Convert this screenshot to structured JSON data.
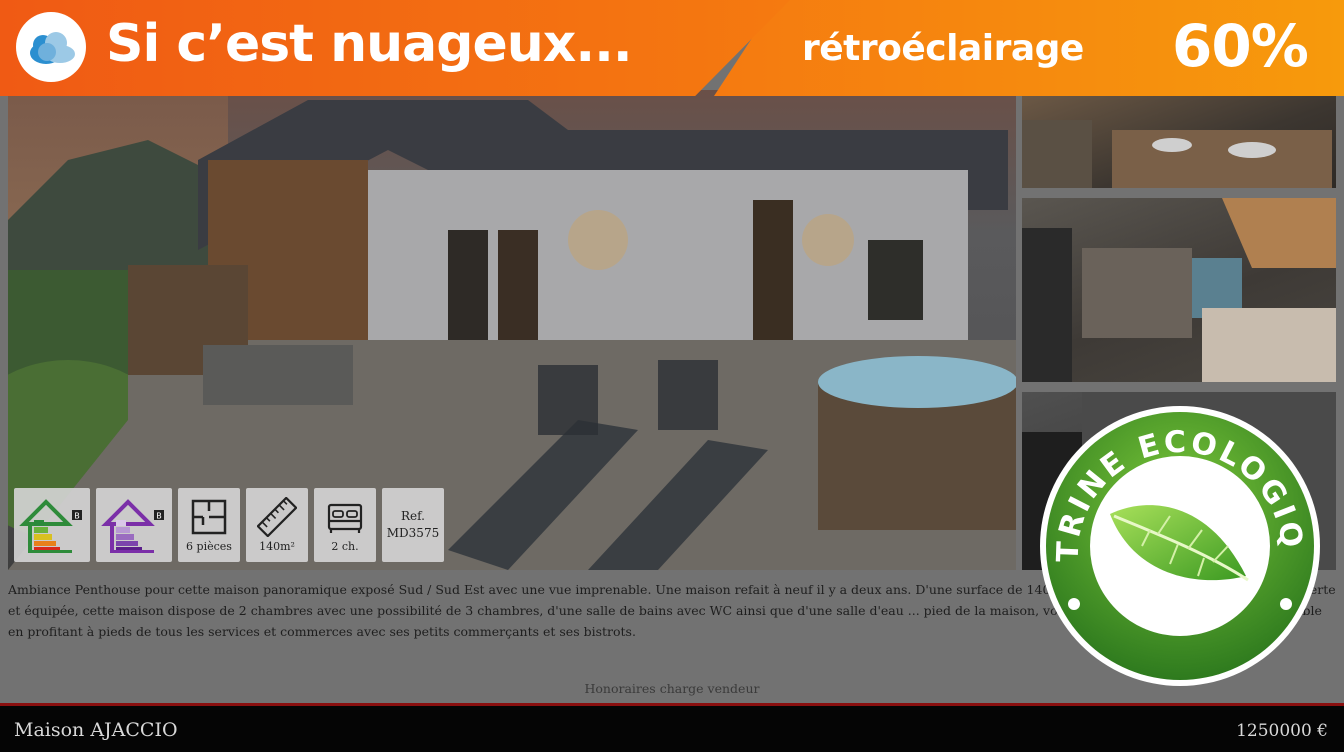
{
  "banner": {
    "title": "Si c’est nuageux...",
    "subtitle": "rétroéclairage",
    "percentage": "60%",
    "icon": "cloud-icon",
    "colors": {
      "left": "#f05a14",
      "right": "#f79a0c"
    }
  },
  "features": [
    {
      "icon": "energy-rating-icon",
      "grade": "B",
      "color": "#2e8b3a"
    },
    {
      "icon": "ghg-rating-icon",
      "grade": "B",
      "color": "#7b2fa8"
    },
    {
      "icon": "floor-plan-icon",
      "label": "6 pièces"
    },
    {
      "icon": "ruler-icon",
      "label": "140m²"
    },
    {
      "icon": "bed-icon",
      "label": "2 ch."
    },
    {
      "ref_label": "Ref.",
      "ref_value": "MD3575"
    }
  ],
  "description": "Ambiance Penthouse pour cette maison panoramique exposé Sud / Sud Est avec une vue imprenable. Une maison refait à neuf il y a deux ans. D'une surface de 140 m² et ... s de 60 m² avec une cuisine ouverte et équipée, cette maison dispose de 2 chambres avec une possibilité de 3 chambres, d'une salle de bains avec WC ainsi que d'une salle d'eau ... pied de la maison, vous trouverez une vie de quartier agréable en profitant à pieds de tous les services et commerces avec ses petits commerçants et ses bistrots.",
  "fees": "Honoraires charge vendeur",
  "property": {
    "name": "Maison AJACCIO",
    "price": "1250000 €"
  },
  "eco_badge": {
    "text": "VITRINE ECOLOGIQUE",
    "icon": "leaf-icon",
    "color": "#4a9a2a"
  }
}
